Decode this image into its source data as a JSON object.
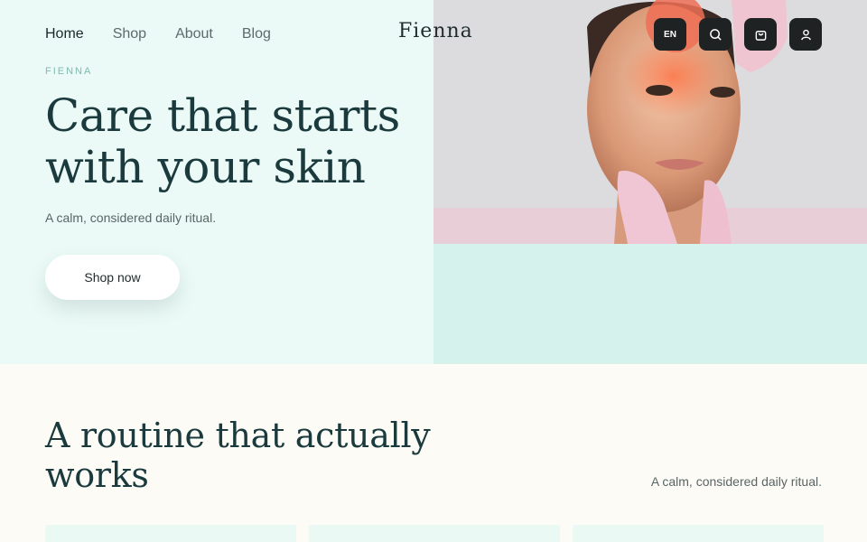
{
  "nav": {
    "items": [
      {
        "label": "Home",
        "active": true
      },
      {
        "label": "Shop",
        "active": false
      },
      {
        "label": "About",
        "active": false
      },
      {
        "label": "Blog",
        "active": false
      }
    ]
  },
  "brand": {
    "logo": "Fienna"
  },
  "header_actions": {
    "language": "EN",
    "icons": [
      "search-icon",
      "bag-icon",
      "user-icon"
    ]
  },
  "hero": {
    "eyebrow": "FIENNA",
    "title": "Care that starts with your skin",
    "subtitle": "A calm, considered daily ritual.",
    "cta": "Shop now"
  },
  "routine": {
    "title": "A routine that actually works",
    "subtitle": "A calm, considered daily ritual."
  },
  "colors": {
    "hero_bg": "#ebfaf6",
    "mint_block": "#d5f3ec",
    "heading": "#1b3a3d",
    "icon_button": "#1f2223",
    "page_bg": "#fcfbf6"
  }
}
